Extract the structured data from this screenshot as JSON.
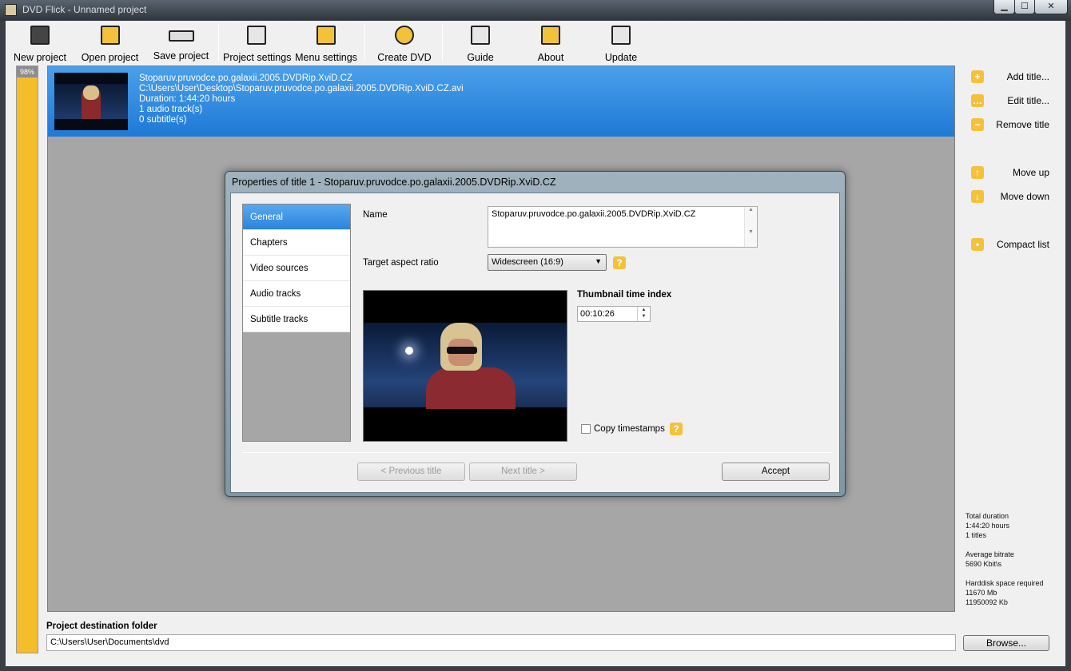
{
  "window": {
    "title": "DVD Flick - Unnamed project",
    "controls": {
      "minimize": "▁",
      "maximize": "☐",
      "close": "✕"
    }
  },
  "toolbar": {
    "new_project": "New project",
    "open_project": "Open project",
    "save_project": "Save project",
    "project_settings": "Project settings",
    "menu_settings": "Menu settings",
    "create_dvd": "Create DVD",
    "guide": "Guide",
    "about": "About",
    "update": "Update"
  },
  "progress": {
    "label": "98%",
    "value": 0.98
  },
  "title_list": {
    "items": [
      {
        "name": "Stoparuv.pruvodce.po.galaxii.2005.DVDRip.XviD.CZ",
        "path": "C:\\Users\\User\\Desktop\\Stoparuv.pruvodce.po.galaxii.2005.DVDRip.XviD.CZ.avi",
        "duration": "Duration: 1:44:20 hours",
        "audio": "1 audio track(s)",
        "subtitles": "0 subtitle(s)"
      }
    ]
  },
  "side_panel": {
    "add_title": "Add title...",
    "edit_title": "Edit title...",
    "remove_title": "Remove title",
    "move_up": "Move up",
    "move_down": "Move down",
    "compact_list": "Compact list"
  },
  "stats": {
    "total_duration_label": "Total duration",
    "total_duration_value": "1:44:20 hours",
    "titles_count": "1 titles",
    "avg_bitrate_label": "Average bitrate",
    "avg_bitrate_value": "5690 Kbit\\s",
    "harddisk_label": "Harddisk space required",
    "harddisk_mb": "11670 Mb",
    "harddisk_kb": "11950092 Kb"
  },
  "destination": {
    "label": "Project destination folder",
    "value": "C:\\Users\\User\\Documents\\dvd",
    "browse": "Browse..."
  },
  "dialog": {
    "title": "Properties of title 1 - Stoparuv.pruvodce.po.galaxii.2005.DVDRip.XviD.CZ",
    "nav": [
      "General",
      "Chapters",
      "Video sources",
      "Audio tracks",
      "Subtitle tracks"
    ],
    "name_label": "Name",
    "name_value": "Stoparuv.pruvodce.po.galaxii.2005.DVDRip.XviD.CZ",
    "aspect_label": "Target aspect ratio",
    "aspect_value": "Widescreen (16:9)",
    "thumb_label": "Thumbnail time index",
    "thumb_value": "00:10:26",
    "copy_timestamps": "Copy timestamps",
    "prev_title": "< Previous title",
    "next_title": "Next title >",
    "accept": "Accept",
    "help": "?"
  },
  "colors": {
    "accent": "#2a84de",
    "highlight": "#f3c23a"
  }
}
